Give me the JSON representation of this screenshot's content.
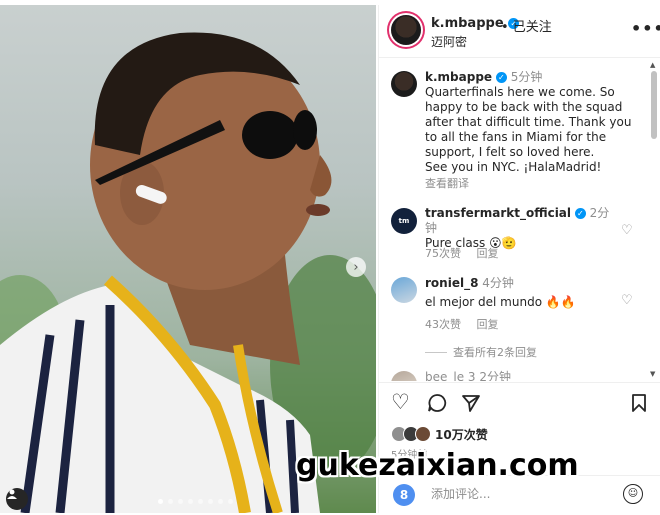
{
  "photo": {
    "next_arrow": "›",
    "slide_count": 8,
    "active_slide": 1
  },
  "header": {
    "username": "k.mbappe",
    "verified_mark": "✓",
    "follow_status": "• 已关注",
    "location": "迈阿密",
    "more": "•••"
  },
  "caption": {
    "username": "k.mbappe",
    "time": "5分钟",
    "text": "Quarterfinals here we come. So happy to be back with the squad after that difficult time. Thank you to all the fans in Miami for the support, I felt so loved here.\nSee you in NYC. ¡HalaMadrid!",
    "see_translation": "查看翻译"
  },
  "comments": [
    {
      "avatar_text": "tm",
      "username": "transfermarkt_official",
      "time": "2分钟",
      "text": "Pure class 😮🫡",
      "likes": "75次赞",
      "reply": "回复"
    },
    {
      "username": "roniel_8",
      "time": "4分钟",
      "text": "el mejor del mundo 🔥🔥",
      "likes": "43次赞",
      "reply": "回复"
    }
  ],
  "view_replies": "查看所有2条回复",
  "partial_comment": "bee_le 3 2分钟",
  "actions": {
    "like_icon": "♡",
    "comment_icon": "◯",
    "share_icon": "➢",
    "save_icon": "🔖"
  },
  "likes": {
    "count_text": "10万次赞"
  },
  "time_ago": "5分钟前",
  "add_comment": {
    "avatar_text": "8",
    "placeholder": "添加评论...",
    "emoji_icon": "☺"
  },
  "watermark": "gukezaixian.com",
  "colors": {
    "verified": "#0095f6",
    "story_ring": "#e1306c",
    "secondary_text": "#8e8e8e"
  }
}
